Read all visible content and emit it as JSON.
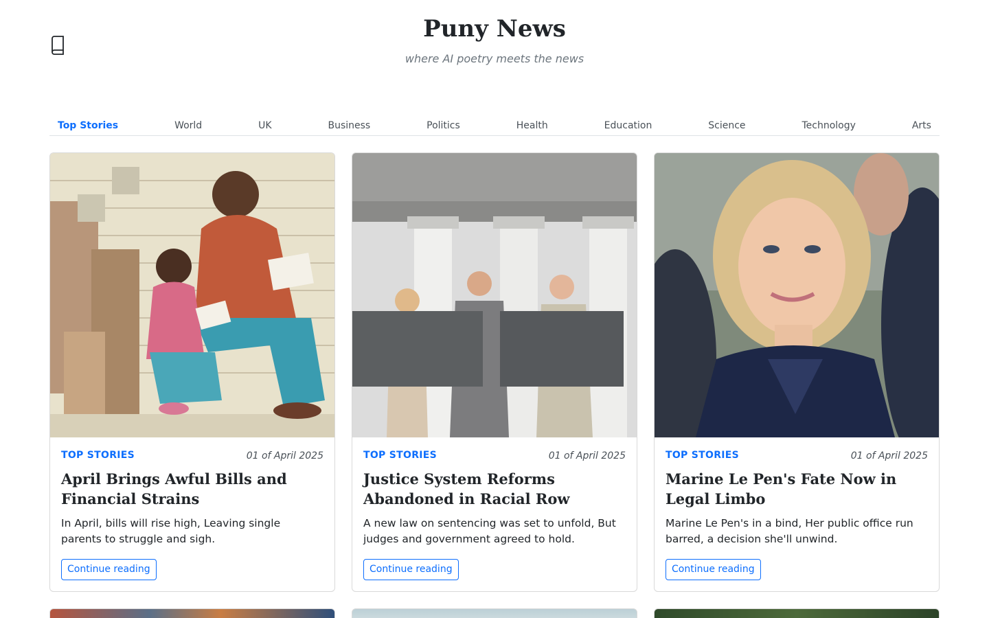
{
  "site": {
    "title": "Puny News",
    "tagline": "where AI poetry meets the news",
    "logo_icon": "book-icon"
  },
  "nav": {
    "items": [
      "Top Stories",
      "World",
      "UK",
      "Business",
      "Politics",
      "Health",
      "Education",
      "Science",
      "Technology",
      "Arts"
    ],
    "active": "Top Stories"
  },
  "articles": [
    {
      "image": "illustration of father and daughter reading bills",
      "category": "TOP STORIES",
      "date": "01 of April 2025",
      "title": "April Brings Awful Bills and Financial Strains",
      "text": "In April, bills will rise high, Leaving single parents to struggle and sigh.",
      "button": "Continue reading"
    },
    {
      "image": "three people at a courthouse with stone tablets",
      "category": "TOP STORIES",
      "date": "01 of April 2025",
      "title": "Justice System Reforms Abandoned in Racial Row",
      "text": "A new law on sentencing was set to unfold, But judges and government agreed to hold.",
      "button": "Continue reading"
    },
    {
      "image": "portrait of a smiling blonde woman in navy jacket",
      "category": "TOP STORIES",
      "date": "01 of April 2025",
      "title": "Marine Le Pen's Fate Now in Legal Limbo",
      "text": "Marine Le Pen's in a bind, Her public office run barred, a decision she'll unwind.",
      "button": "Continue reading"
    }
  ],
  "colors": {
    "accent": "#0d6efd",
    "text": "#212529",
    "muted": "#6c757d",
    "border": "#dee2e6"
  }
}
